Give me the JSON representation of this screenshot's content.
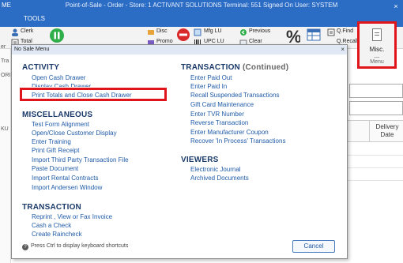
{
  "window": {
    "title": "Point-of-Sale - Order - Store: 1 ACTIVANT SOLUTIONS Terminal: 551 Signed On User: SYSTEM",
    "menu_left": "ME",
    "tab_tools": "TOOLS",
    "close_glyph": "×"
  },
  "toolbar": {
    "clerk": "Clerk",
    "total": "Total",
    "disc": "Disc",
    "promo": "Promo",
    "mfg_lu": "Mfg LU",
    "upc_lu": "UPC LU",
    "previous": "Previous",
    "clear": "Clear",
    "q_find": "Q.Find",
    "q_recall": "Q.Recall",
    "misc": "Misc.",
    "misc_dots": "...",
    "menu_group": "Menu"
  },
  "background": {
    "left_labels": [
      "er",
      "Tra",
      "ORI",
      "KU"
    ],
    "delivery_date": "Delivery Date"
  },
  "dialog": {
    "title": "No Sale Menu",
    "close_glyph": "×",
    "activity": {
      "heading": "ACTIVITY",
      "items": [
        "Open Cash Drawer",
        "Display Cash Drawer",
        "Print Totals and Close Cash Drawer"
      ]
    },
    "miscellaneous": {
      "heading": "MISCELLANEOUS",
      "items": [
        "Test Form Alignment",
        "Open/Close Customer Display",
        "Enter Training",
        "Print Gift Receipt",
        "Import Third Party Transaction File",
        "Paste Document",
        "Import Rental Contracts",
        "Import Andersen Window"
      ]
    },
    "transaction_left": {
      "heading": "TRANSACTION",
      "items": [
        "Reprint , View or Fax Invoice",
        "Cash a Check",
        "Create Raincheck"
      ]
    },
    "transaction_right": {
      "heading": "TRANSACTION",
      "continued": "(Continued)",
      "items": [
        "Enter Paid Out",
        "Enter Paid In",
        "Recall Suspended Transactions",
        "Gift Card Maintenance",
        "Enter TVR Number",
        "Reverse Transaction",
        "Enter Manufacturer Coupon",
        "Recover 'In Process' Transactions"
      ]
    },
    "viewers": {
      "heading": "VIEWERS",
      "items": [
        "Electronic Journal",
        "Archived Documents"
      ]
    },
    "hint": "Press Ctrl to display keyboard shortcuts",
    "hint_icon": "?",
    "cancel": "Cancel"
  },
  "colors": {
    "titlebar": "#2b6cc4",
    "link": "#1f5ba8",
    "heading": "#1a3a6a",
    "highlight": "#e0141b"
  }
}
